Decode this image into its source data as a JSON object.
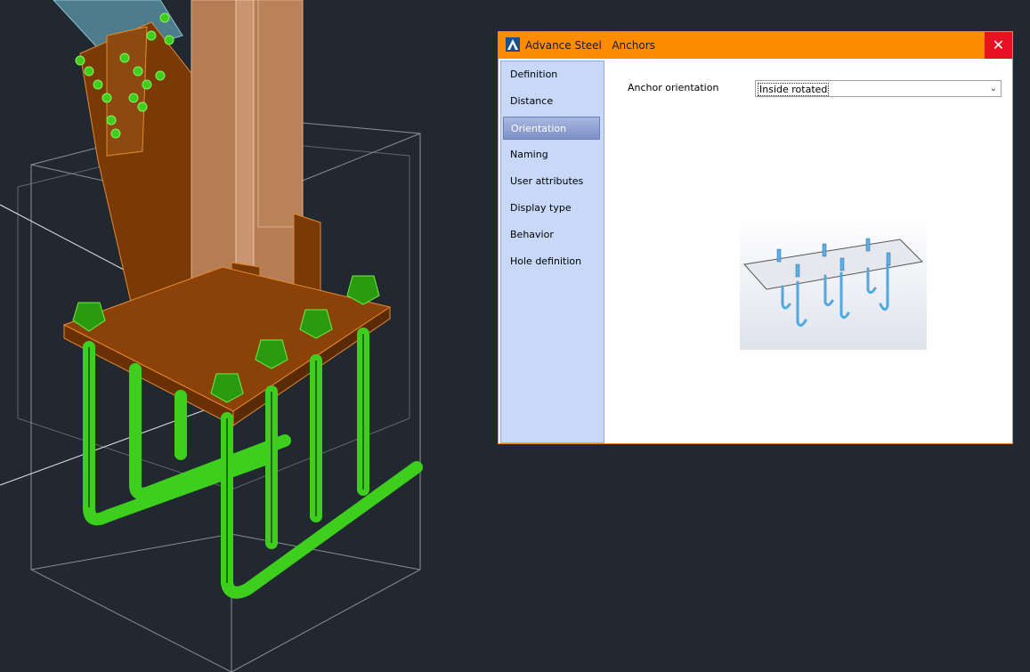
{
  "dialog": {
    "title": "Advance Steel   Anchors",
    "close_glyph": "✕",
    "sidebar": {
      "items": [
        {
          "label": "Definition"
        },
        {
          "label": "Distance"
        },
        {
          "label": "Orientation",
          "selected": true
        },
        {
          "label": "Naming"
        },
        {
          "label": "User attributes"
        },
        {
          "label": "Display type"
        },
        {
          "label": "Behavior"
        },
        {
          "label": "Hole definition"
        }
      ]
    },
    "content": {
      "orientation_label": "Anchor orientation",
      "orientation_value": "Inside rotated"
    }
  },
  "icons": {
    "app": "autocad-a-icon",
    "close": "close-icon",
    "dropdown": "chevron-down-icon"
  },
  "colors": {
    "viewport_bg": "#212830",
    "titlebar": "#ff8c00",
    "close_button": "#e81123",
    "sidebar_bg": "#c8d8f8",
    "steel": "#7a3a06",
    "anchor_green": "#3ecf1e"
  }
}
